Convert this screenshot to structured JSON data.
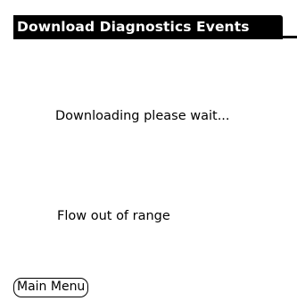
{
  "form": {
    "title": "Download Diagnostics Events"
  },
  "body": {
    "status": "Downloading please wait...",
    "message": "Flow out of range"
  },
  "buttons": {
    "main_menu": "Main Menu"
  },
  "colors": {
    "title_bar_bg": "#000000",
    "title_text": "#ffffff",
    "background": "#ffffff",
    "text": "#000000"
  }
}
